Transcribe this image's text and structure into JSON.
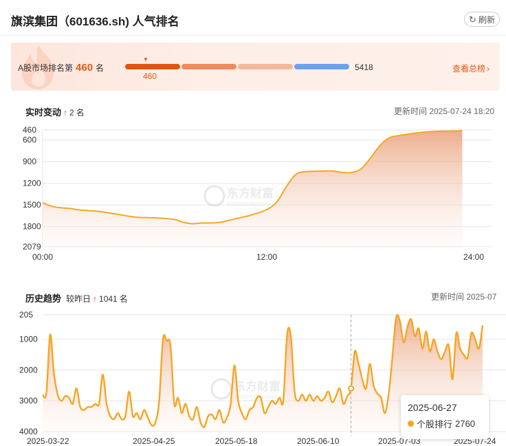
{
  "header": {
    "title": "旗滨集团（601636.sh) 人气排名",
    "refresh_label": "刷新"
  },
  "rank_card": {
    "label": "A股市场排名第",
    "rank": "460",
    "unit": "名",
    "position_label": "460",
    "total": "5418",
    "view_all_label": "查看总榜",
    "segment_colors": [
      "#e0540f",
      "#ee8a5d",
      "#f5b89c",
      "#6ea0f0"
    ]
  },
  "realtime": {
    "title": "实时变动",
    "change": "2",
    "change_unit": "名",
    "update_time": "更新时间 2025-07-24 18:20"
  },
  "history": {
    "title": "历史趋势",
    "compare_label": "较昨日",
    "change": "1041",
    "change_unit": "名",
    "update_time": "更新时间 2025-07"
  },
  "watermark": {
    "cn": "东方财富",
    "en": "eastmoney.com"
  },
  "tooltip": {
    "date": "2025-06-27",
    "series_label": "个股排行",
    "value": "2760"
  },
  "chart_data": [
    {
      "type": "area",
      "name": "realtime",
      "x_ticks": [
        "00:00",
        "12:00",
        "24:00"
      ],
      "y_ticks": [
        "460",
        "600",
        "900",
        "1200",
        "1500",
        "1800",
        "2079"
      ],
      "y_reversed": true,
      "ylim": [
        460,
        2079
      ],
      "xlim": [
        0,
        24
      ],
      "grid": true,
      "color": "#f5a623",
      "points": [
        [
          0,
          1470
        ],
        [
          0.5,
          1520
        ],
        [
          1,
          1540
        ],
        [
          1.5,
          1550
        ],
        [
          2,
          1570
        ],
        [
          3,
          1590
        ],
        [
          4,
          1630
        ],
        [
          5,
          1670
        ],
        [
          6,
          1680
        ],
        [
          7,
          1700
        ],
        [
          7.5,
          1740
        ],
        [
          8,
          1760
        ],
        [
          8.5,
          1750
        ],
        [
          9,
          1750
        ],
        [
          9.5,
          1740
        ],
        [
          10,
          1710
        ],
        [
          10.5,
          1680
        ],
        [
          11,
          1650
        ],
        [
          11.5,
          1610
        ],
        [
          12,
          1560
        ],
        [
          12.5,
          1460
        ],
        [
          13,
          1250
        ],
        [
          13.5,
          1080
        ],
        [
          14,
          1040
        ],
        [
          15,
          1030
        ],
        [
          15.5,
          1030
        ],
        [
          16,
          1050
        ],
        [
          16.5,
          1050
        ],
        [
          17,
          1000
        ],
        [
          17.5,
          850
        ],
        [
          18,
          680
        ],
        [
          18.5,
          570
        ],
        [
          19,
          540
        ],
        [
          19.5,
          520
        ],
        [
          20,
          500
        ],
        [
          21,
          480
        ],
        [
          22,
          475
        ],
        [
          22.4,
          470
        ]
      ]
    },
    {
      "type": "area",
      "name": "history",
      "x_ticks": [
        "2025-03-22",
        "2025-04-25",
        "2025-05-18",
        "2025-06-10",
        "2025-07-03",
        "2025-07-24"
      ],
      "y_ticks": [
        "205",
        "1000",
        "2000",
        "3000",
        "4000"
      ],
      "y_reversed": true,
      "ylim": [
        205,
        4000
      ],
      "grid": true,
      "color": "#f5a623",
      "highlight_index": 82,
      "values": [
        2800,
        2750,
        850,
        2100,
        2800,
        3000,
        2850,
        2900,
        3100,
        2600,
        3200,
        3300,
        3200,
        3200,
        3100,
        3100,
        2150,
        3100,
        3500,
        3600,
        3400,
        3600,
        3500,
        2700,
        3500,
        3400,
        3600,
        3300,
        3550,
        3800,
        3700,
        3000,
        1000,
        1050,
        1200,
        3100,
        2900,
        3400,
        3100,
        3500,
        3600,
        3200,
        3700,
        3850,
        3500,
        3450,
        3600,
        3300,
        3700,
        3550,
        3100,
        1850,
        3000,
        3400,
        3600,
        3300,
        3200,
        2900,
        2900,
        3400,
        3200,
        3000,
        3100,
        2900,
        3000,
        850,
        900,
        2700,
        3000,
        2800,
        3000,
        2800,
        3000,
        2850,
        3000,
        2900,
        2700,
        3050,
        2850,
        2600,
        3100,
        2850,
        2600,
        1400,
        1800,
        2300,
        2600,
        1800,
        2500,
        2760,
        2900,
        3400,
        2800,
        1600,
        300,
        400,
        1100,
        600,
        350,
        900,
        650,
        1300,
        750,
        1400,
        1000,
        1400,
        1650,
        1400,
        1200,
        2300,
        800,
        1300,
        1500,
        1600,
        800,
        1000,
        1300,
        550
      ]
    }
  ]
}
